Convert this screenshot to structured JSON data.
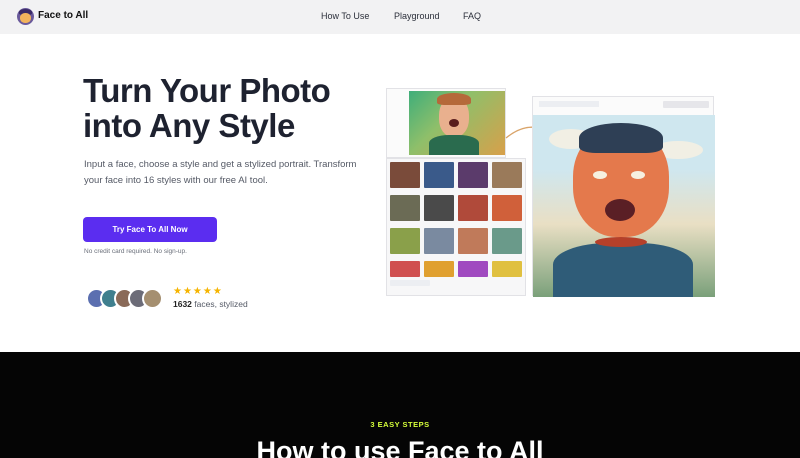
{
  "nav": {
    "brand": "Face to All",
    "links": [
      "How To Use",
      "Playground",
      "FAQ"
    ]
  },
  "hero": {
    "title": "Turn Your Photo into Any Style",
    "description": "Input a face, choose a style and get a stylized portrait. Transform your face into 16 styles with our free AI tool.",
    "cta_label": "Try Face To All Now",
    "cta_note": "No credit card required. No sign-up.",
    "stars": "★★★★★",
    "faces_count": "1632",
    "faces_suffix": " faces, stylized",
    "brand_color": "#5b2df0",
    "star_color": "#f5b400"
  },
  "steps": {
    "label": "3 EASY STEPS",
    "title": "How to use Face to All",
    "label_color": "#d6ff3a"
  },
  "icons": [
    "logo-icon"
  ]
}
